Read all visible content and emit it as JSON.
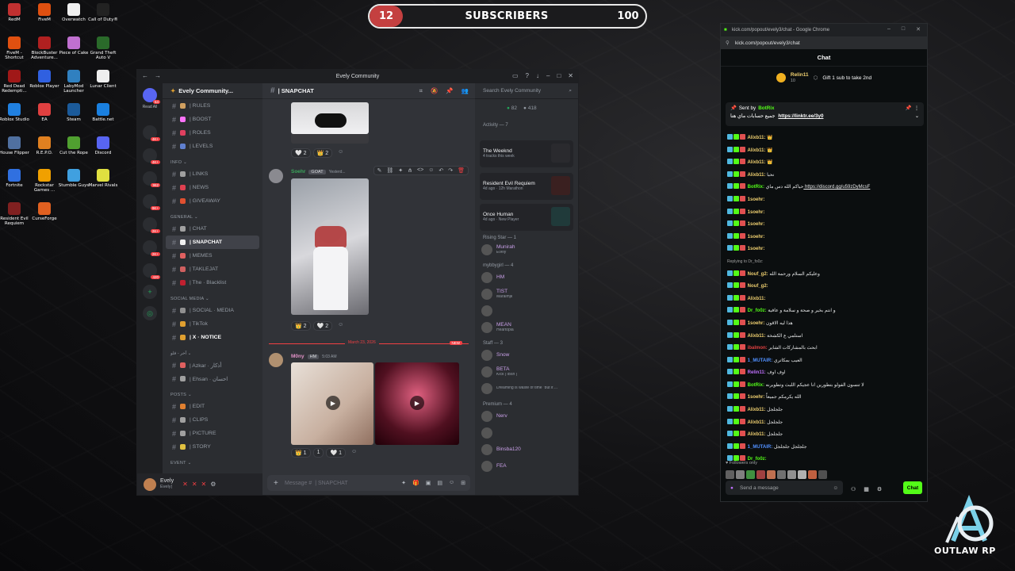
{
  "subscribers": {
    "current": "12",
    "label": "SUBSCRIBERS",
    "goal": "100",
    "progress_fraction": 0.12
  },
  "desktop_icons": [
    {
      "label": "RedM",
      "color": "#c03030"
    },
    {
      "label": "FiveM",
      "color": "#e05010"
    },
    {
      "label": "Overwatch",
      "color": "#f0f0f0"
    },
    {
      "label": "Call of Duty®",
      "color": "#222"
    },
    {
      "label": "FiveM - Shortcut",
      "color": "#e05010"
    },
    {
      "label": "BlockBuster Adventure...",
      "color": "#b02020"
    },
    {
      "label": "Piece of Cake",
      "color": "#c070d0"
    },
    {
      "label": "Grand Theft Auto V",
      "color": "#2a6a2a"
    },
    {
      "label": "Red Dead Redempti...",
      "color": "#a01818"
    },
    {
      "label": "Roblox Player",
      "color": "#3060e0"
    },
    {
      "label": "LabyMod Launcher",
      "color": "#3080c0"
    },
    {
      "label": "Lunar Client",
      "color": "#eeeeee"
    },
    {
      "label": "Roblox Studio",
      "color": "#2080e0"
    },
    {
      "label": "EA",
      "color": "#e04040"
    },
    {
      "label": "Steam",
      "color": "#1b5a9a"
    },
    {
      "label": "Battle.net",
      "color": "#1a80e0"
    },
    {
      "label": "House Flipper",
      "color": "#5070a0"
    },
    {
      "label": "R.E.P.O.",
      "color": "#e08020"
    },
    {
      "label": "Cut the Rope",
      "color": "#50a030"
    },
    {
      "label": "Discord",
      "color": "#5865f2"
    },
    {
      "label": "Fortnite",
      "color": "#3070e0"
    },
    {
      "label": "Rockstar Games ...",
      "color": "#f0a000"
    },
    {
      "label": "Stumble Guys",
      "color": "#40a0e0"
    },
    {
      "label": "Marvel Rivals",
      "color": "#e0e040"
    },
    {
      "label": "Resident Evil Requiem",
      "color": "#802020"
    },
    {
      "label": "CurseForge",
      "color": "#e06020"
    }
  ],
  "discord": {
    "window_title": "Evely Community",
    "server_name": "Evely Community...",
    "rail_label": "Read All",
    "rail_badges": [
      "64",
      "4K+",
      "4K+",
      "962",
      "9K+",
      "2K+",
      "2K+",
      "420"
    ],
    "channels": [
      {
        "name": "| RULES",
        "type": "ch",
        "emoji": "#d0a060"
      },
      {
        "name": "| BOOST",
        "type": "ch",
        "emoji": "#ff73fa"
      },
      {
        "name": "| ROLES",
        "type": "ch",
        "emoji": "#e04060"
      },
      {
        "name": "| LEVELS",
        "type": "ch",
        "emoji": "#6080d0"
      },
      {
        "name": "INFO",
        "type": "cat"
      },
      {
        "name": "| LINKS",
        "type": "ch",
        "emoji": "#a0a0a0"
      },
      {
        "name": "| NEWS",
        "type": "ch",
        "emoji": "#e04050"
      },
      {
        "name": "| GIVEAWAY",
        "type": "ch",
        "emoji": "#e05030"
      },
      {
        "name": "GENERAL",
        "type": "cat"
      },
      {
        "name": "| CHAT",
        "type": "ch",
        "emoji": "#a0a0a0"
      },
      {
        "name": "| SNAPCHAT",
        "type": "active",
        "emoji": "#f0f0f0"
      },
      {
        "name": "| MEMES",
        "type": "ch",
        "emoji": "#e06060"
      },
      {
        "name": "| TAKLEJAT",
        "type": "ch",
        "emoji": "#d06060"
      },
      {
        "name": "| The · Blacklist",
        "type": "ch",
        "emoji": "#c02030"
      },
      {
        "name": "SOCIAL MEDIA",
        "type": "cat"
      },
      {
        "name": "| SOCIAL · MEDIA",
        "type": "ch",
        "emoji": "#909090"
      },
      {
        "name": "| TikTok",
        "type": "ch",
        "emoji": "#e0a030"
      },
      {
        "name": "| X · NOTICE",
        "type": "bold",
        "emoji": "#e0a030"
      },
      {
        "name": "آخر - فلو",
        "type": "cat"
      },
      {
        "name": "| Azkar · أذكار",
        "type": "ch",
        "emoji": "#e06060"
      },
      {
        "name": "| Ehsan · احسان",
        "type": "ch",
        "emoji": "#a0a0a0"
      },
      {
        "name": "POSTS",
        "type": "cat"
      },
      {
        "name": "| EDIT",
        "type": "ch",
        "emoji": "#e08030"
      },
      {
        "name": "| CLIPS",
        "type": "ch",
        "emoji": "#a0a0a0"
      },
      {
        "name": "| PICTURE",
        "type": "ch",
        "emoji": "#a0a0a0"
      },
      {
        "name": "| STORY",
        "type": "ch",
        "emoji": "#e0c040"
      },
      {
        "name": "EVENT",
        "type": "cat"
      }
    ],
    "channel_header": "| SNAPCHAT",
    "user": {
      "name": "Evely",
      "status": "Evely|"
    },
    "messages": {
      "m1_author": "Soehr",
      "m1_tag": "GOAT",
      "m1_time": "Yesterd...",
      "date_divider": "March 23, 2026",
      "new_label": "NEW",
      "m2_author": "M0ny",
      "m2_tag": "HM",
      "m2_time": "5:03 AM",
      "reactions_top": [
        "🤍 2",
        "👑 2"
      ],
      "reactions_mid": [
        "👑 2",
        "🤍 2"
      ],
      "reactions_bottom": [
        "👑 1",
        "1",
        "🤍 1"
      ]
    },
    "composer_placeholder": "Message #",
    "composer_channel": "| SNAPCHAT",
    "member_search": "Search Evely Community",
    "member_counts": {
      "online": "82",
      "total": "418"
    },
    "activity": {
      "header": "Activity — 7",
      "items": [
        {
          "title": "The Weeknd",
          "sub": "4 tracks this week"
        },
        {
          "title": "Resident Evil Requiem",
          "sub": "4d ago · 12h Marathon"
        },
        {
          "title": "Once Human",
          "sub": "4d ago · New Player"
        }
      ]
    },
    "member_groups": [
      {
        "label": "Rising Star — 1",
        "members": [
          {
            "name": "Munirah",
            "sub": "Evely"
          }
        ]
      },
      {
        "label": "mybbygirl — 4",
        "members": [
          {
            "name": "HM",
            "sub": ""
          },
          {
            "name": "TIST",
            "sub": "Maraimjk"
          },
          {
            "name": "",
            "sub": ""
          },
          {
            "name": "MEAN",
            "sub": "Heartopia"
          }
        ]
      },
      {
        "label": "Staff — 3",
        "members": [
          {
            "name": "Snow",
            "sub": ""
          },
          {
            "name": "BETA",
            "sub": "Kick | iBsh |"
          },
          {
            "name": "",
            "sub": "Dreaming is waste of time \"but it ..."
          }
        ]
      },
      {
        "label": "Premium — 4",
        "members": [
          {
            "name": "Nerv",
            "sub": ""
          },
          {
            "name": "",
            "sub": ""
          },
          {
            "name": "Binsba120",
            "sub": ""
          },
          {
            "name": "FEA",
            "sub": ""
          }
        ]
      }
    ]
  },
  "kick": {
    "window_title": "kick.com/popout/evely3/chat - Google Chrome",
    "url": "kick.com/popout/evely3/chat",
    "header": "Chat",
    "gift_user": "Relin11",
    "gift_count": "10",
    "gift_text": "Gift 1 sub to take 2nd",
    "pinned": {
      "sent_by": "Sent by",
      "author": "BotRix",
      "text": "جميع حسابات ماي هنا",
      "link": "https://linktr.ee/3y0"
    },
    "lines": [
      {
        "user": "Alixb11:",
        "color": "#f0d070",
        "text": "👑"
      },
      {
        "user": "Alixb11:",
        "color": "#f0d070",
        "text": "👑"
      },
      {
        "user": "Alixb11:",
        "color": "#f0d070",
        "text": "👑"
      },
      {
        "user": "Alixb11:",
        "color": "#f0d070",
        "text": "نحبا"
      },
      {
        "user": "BotRix:",
        "color": "#53fc18",
        "text": "حياكم الله دس ماي",
        "link": "https://discord.gg/u59zDyMcsF"
      },
      {
        "user": "1soehr:",
        "color": "#f0d070",
        "text": ""
      },
      {
        "user": "1soehr:",
        "color": "#f0d070",
        "text": ""
      },
      {
        "user": "1soehr:",
        "color": "#f0d070",
        "text": ""
      },
      {
        "user": "1soehr:",
        "color": "#f0d070",
        "text": ""
      },
      {
        "user": "1soehr:",
        "color": "#f0d070",
        "text": ""
      },
      {
        "user": "",
        "color": "#a0a0a0",
        "text": "Replying to Dr_fo0z:"
      },
      {
        "user": "Nouf_g2:",
        "color": "#f0d070",
        "text": "وعليكم السلام ورحمة الله"
      },
      {
        "user": "Nouf_g2:",
        "color": "#f0d070",
        "text": ""
      },
      {
        "user": "Alixb11:",
        "color": "#f0d070",
        "text": ""
      },
      {
        "user": "Dr_fo0z:",
        "color": "#53fc18",
        "text": "و انتم بخير و صحة و سلامة و عافية"
      },
      {
        "user": "1soehr:",
        "color": "#f0d070",
        "text": "هذا ليه الاقون"
      },
      {
        "user": "Alixb11:",
        "color": "#f0d070",
        "text": "استلمي ع الكشخة"
      },
      {
        "user": "ibalmon:",
        "color": "#e04040",
        "text": "ابحث بالمشاركات الشاير"
      },
      {
        "user": "1_MUTAIR:",
        "color": "#5090ff",
        "text": "العيب بمكاتري"
      },
      {
        "user": "Relin11:",
        "color": "#c070ff",
        "text": "اوف اوف"
      },
      {
        "user": "BotRix:",
        "color": "#53fc18",
        "text": "لا تنسون الفولو بتطورين انا عجيكم اللبث وتطويرنه"
      },
      {
        "user": "1soehr:",
        "color": "#f0d070",
        "text": "الله يكرمكم جميعاً"
      },
      {
        "user": "Alixb11:",
        "color": "#f0d070",
        "text": "جلجلجل"
      },
      {
        "user": "Alixb11:",
        "color": "#f0d070",
        "text": "جلجلجل"
      },
      {
        "user": "Alixb11:",
        "color": "#f0d070",
        "text": "جلجلجل"
      },
      {
        "user": "1_MUTAIR:",
        "color": "#5090ff",
        "text": "جلجلجل جلجلجل"
      },
      {
        "user": "Dr_fo0z:",
        "color": "#53fc18",
        "text": ""
      }
    ],
    "followers_only": "Followers only",
    "input_placeholder": "Send a message",
    "chat_button": "Chat"
  },
  "brand": {
    "logo_text": "OUTLAW RP",
    "accent": "#7ad0e8"
  }
}
